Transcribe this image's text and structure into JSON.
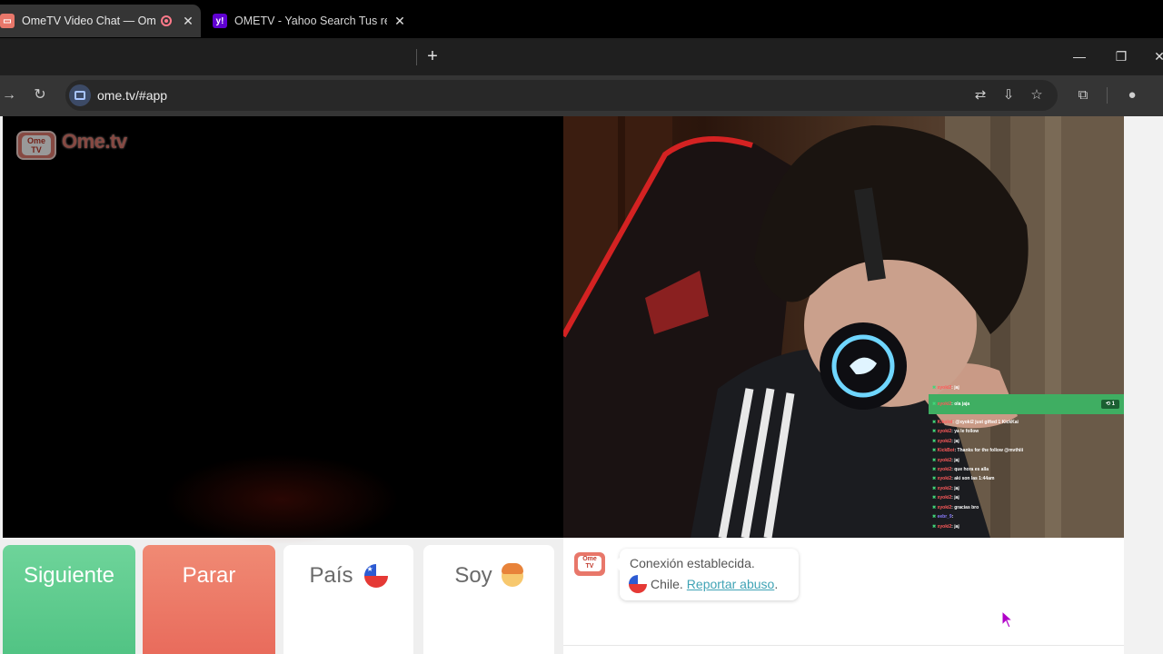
{
  "browser": {
    "tabs": [
      {
        "title": "OmeTV Video Chat — Ome",
        "active": true,
        "favicon": "ometv-favicon",
        "recording": true
      },
      {
        "title": "OMETV - Yahoo Search Tus resu",
        "active": false,
        "favicon": "yahoo-favicon"
      }
    ],
    "new_tab_icon": "plus-icon",
    "url": "ome.tv/#app",
    "window_controls": [
      "minimize-icon",
      "restore-icon",
      "close-icon"
    ],
    "toolbar_icons": [
      "translate-icon",
      "install-app-icon",
      "bookmark-star-icon",
      "extensions-icon",
      "profile-icon"
    ]
  },
  "app": {
    "logo_screen_text": "Ome\nTV",
    "logo_text": "Ome.tv",
    "controls": {
      "next_label": "Siguiente",
      "stop_label": "Parar",
      "country_label": "País",
      "gender_label": "Soy"
    },
    "chat": {
      "status_message": "Conexión establecida.",
      "country": "Chile.",
      "report_link": "Reportar abuso",
      "after_link": ".",
      "avatar_text": "Ome\nTV"
    },
    "colors": {
      "next": "#4fc282",
      "stop": "#e8695a",
      "link": "#3fa3b5"
    }
  },
  "stream_overlay": {
    "lines": [
      {
        "user": "xyoki2",
        "text": ": jaj"
      },
      {
        "user": "xyoki2",
        "text": ": ola jaja",
        "highlight": true
      },
      {
        "user": "Kikolol",
        "text": ": @xyoki2 just gifted 1 KickKai"
      },
      {
        "user": "xyoki2",
        "text": ": ya le follow"
      },
      {
        "user": "xyoki2",
        "text": ": jaj"
      },
      {
        "user": "KickBot",
        "text": ": Thanks for the follow @mvthiii"
      },
      {
        "user": "xyoki2",
        "text": ": jaj"
      },
      {
        "user": "xyoki2",
        "text": ": que hora es alla"
      },
      {
        "user": "xyoki2",
        "text": ": aki son las 1:44am"
      },
      {
        "user": "xyoki2",
        "text": ": jaj"
      },
      {
        "user": "xyoki2",
        "text": ": jaj"
      },
      {
        "user": "xyoki2",
        "text": ": gracias bro"
      },
      {
        "user": "eebr_9",
        "text": ": "
      },
      {
        "user": "xyoki2",
        "text": ": jaj"
      }
    ],
    "badge": "⟲ 1"
  }
}
